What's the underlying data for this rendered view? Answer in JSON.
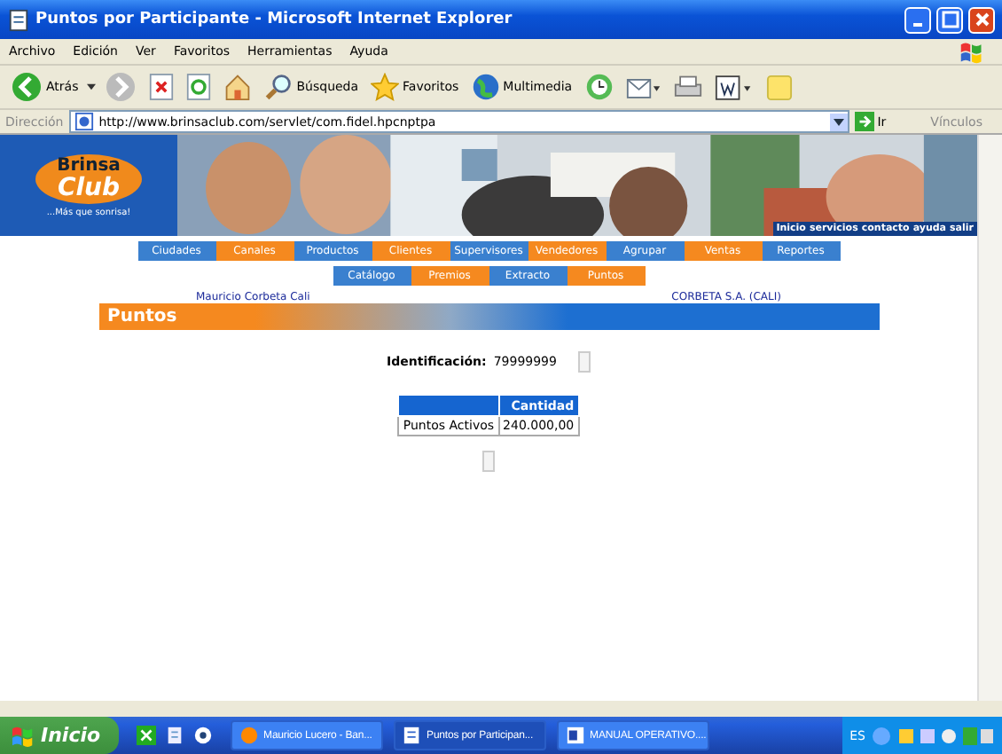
{
  "window": {
    "title": "Puntos por Participante - Microsoft Internet Explorer"
  },
  "menu": [
    "Archivo",
    "Edición",
    "Ver",
    "Favoritos",
    "Herramientas",
    "Ayuda"
  ],
  "toolbar": [
    {
      "kind": "back",
      "label": "Atrás"
    },
    {
      "kind": "forward"
    },
    {
      "kind": "stop"
    },
    {
      "kind": "refresh"
    },
    {
      "kind": "home"
    },
    {
      "kind": "search",
      "label": "Búsqueda"
    },
    {
      "kind": "favorites",
      "label": "Favoritos"
    },
    {
      "kind": "media",
      "label": "Multimedia"
    },
    {
      "kind": "history"
    },
    {
      "kind": "mail"
    },
    {
      "kind": "print"
    },
    {
      "kind": "edit"
    },
    {
      "kind": "note"
    }
  ],
  "address": {
    "label": "Dirección",
    "value": "http://www.brinsaclub.com/servlet/com.fidel.hpcnptpa",
    "go": "Ir",
    "links": "Vínculos"
  },
  "banner": {
    "logo_top": "Brinsa",
    "logo_main": "Club",
    "slogan": "...Más que sonrisa!",
    "links": [
      "Inicio",
      "servicios",
      "contacto",
      "ayuda",
      "salir"
    ]
  },
  "nav_main": [
    "Ciudades",
    "Canales",
    "Productos",
    "Clientes",
    "Supervisores",
    "Vendedores",
    "Agrupar",
    "Ventas",
    "Reportes"
  ],
  "nav_sub": [
    "Catálogo",
    "Premios",
    "Extracto",
    "Puntos"
  ],
  "user": "Mauricio Corbeta Cali",
  "company": "CORBETA S.A. (CALI)",
  "section_title": "Puntos",
  "identification": {
    "label": "Identificación:",
    "value": "79999999"
  },
  "table": {
    "columns": [
      "",
      "Cantidad"
    ],
    "rows": [
      [
        "Puntos Activos",
        "240.000,00"
      ]
    ]
  },
  "taskbar": {
    "start": "Inicio",
    "tasks": [
      {
        "label": "Mauricio Lucero - Ban...",
        "kind": "browser",
        "selected": false
      },
      {
        "label": "Puntos por Participan...",
        "kind": "ie",
        "selected": true
      },
      {
        "label": "MANUAL OPERATIVO....",
        "kind": "doc",
        "selected": false
      }
    ],
    "lang": "ES"
  }
}
